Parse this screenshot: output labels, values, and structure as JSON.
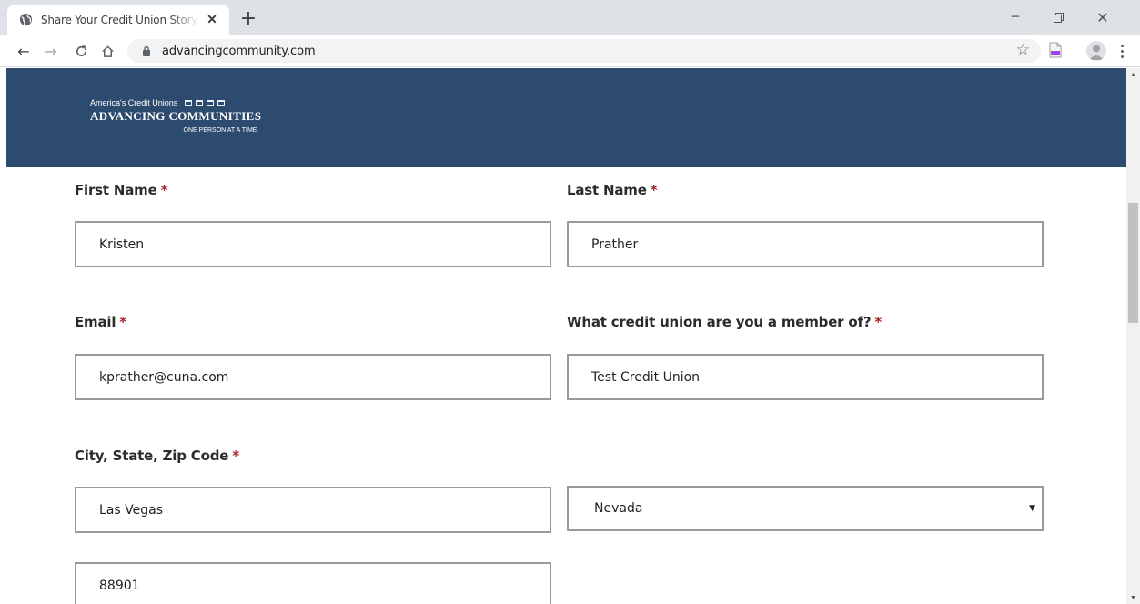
{
  "browser": {
    "tab_title": "Share Your Credit Union Story - C",
    "url": "advancingcommunity.com",
    "new_tab_symbol": "+",
    "icons": {
      "favicon": "globe-icon",
      "close": "close-icon",
      "back": "arrow-left-icon",
      "forward": "arrow-right-icon",
      "reload": "reload-icon",
      "home": "home-icon",
      "lock": "lock-icon",
      "bookmark": "star-icon",
      "extension": "pdf-extension-icon",
      "profile": "avatar-icon",
      "menu": "kebab-menu-icon"
    }
  },
  "header": {
    "logo": {
      "line1": "America's Credit Unions",
      "line2": "ADVANCING COMMUNITIES",
      "line3": "ONE PERSON AT A TIME"
    },
    "band_color": "#2d4a6f"
  },
  "form": {
    "required_marker": "*",
    "first_name": {
      "label": "First Name",
      "value": "Kristen"
    },
    "last_name": {
      "label": "Last Name",
      "value": "Prather"
    },
    "email": {
      "label": "Email",
      "value": "kprather@cuna.com"
    },
    "credit_union": {
      "label": "What credit union are you a member of?",
      "value": "Test Credit Union"
    },
    "location": {
      "label": "City, State, Zip Code",
      "city": "Las Vegas",
      "state": "Nevada",
      "zip": "88901"
    }
  },
  "colors": {
    "required": "#a4262c",
    "input_border": "#9a9a9a"
  }
}
